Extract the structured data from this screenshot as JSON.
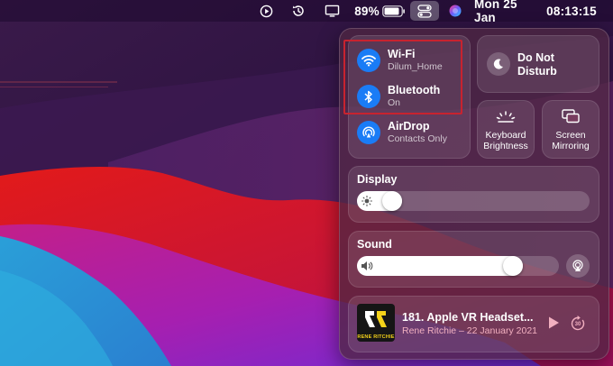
{
  "menubar": {
    "battery_percent": "89%",
    "date": "Mon 25 Jan",
    "time": "08:13:15",
    "battery_level": 0.89,
    "icons": [
      "play-icon",
      "time-machine-icon",
      "display-icon",
      "battery-icon",
      "control-center-icon",
      "siri-icon"
    ]
  },
  "control_center": {
    "wifi": {
      "title": "Wi-Fi",
      "subtitle": "Dilum_Home"
    },
    "bluetooth": {
      "title": "Bluetooth",
      "subtitle": "On"
    },
    "airdrop": {
      "title": "AirDrop",
      "subtitle": "Contacts Only"
    },
    "dnd": {
      "title_line1": "Do Not",
      "title_line2": "Disturb"
    },
    "keyboard_brightness": {
      "line1": "Keyboard",
      "line2": "Brightness"
    },
    "screen_mirroring": {
      "line1": "Screen",
      "line2": "Mirroring"
    },
    "display": {
      "title": "Display",
      "level": 0.12
    },
    "sound": {
      "title": "Sound",
      "level": 0.8
    },
    "now_playing": {
      "title": "181. Apple VR Headset...",
      "subtitle": "Rene Ritchie – 22 January 2021",
      "art_caption": "RENE RITCHIE",
      "skip_label": "30"
    }
  },
  "colors": {
    "accent_blue": "#1a7cf6",
    "highlight_red": "#c8232f",
    "subtitle_pink": "#f2b0c0"
  }
}
